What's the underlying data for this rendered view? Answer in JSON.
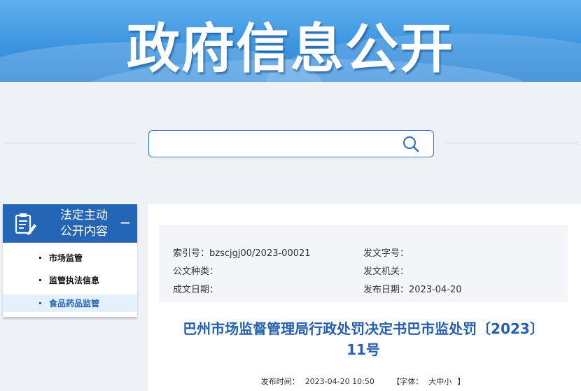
{
  "banner": {
    "title": "政府信息公开"
  },
  "search": {
    "placeholder": "",
    "value": ""
  },
  "sidebar": {
    "title_line1": "法定主动",
    "title_line2": "公开内容",
    "collapse_symbol": "−",
    "items": [
      {
        "label": "市场监管"
      },
      {
        "label": "监管执法信息"
      },
      {
        "label": "食品药品监管"
      }
    ]
  },
  "meta": {
    "index_label": "索引号：",
    "index_value": "bzscjgj00/2023-00021",
    "doc_no_label": "发文字号：",
    "doc_no_value": "",
    "category_label": "公文种类：",
    "category_value": "",
    "issuer_label": "发文机关：",
    "issuer_value": "",
    "created_label": "成文日期：",
    "created_value": "",
    "published_label": "发布日期：",
    "published_value": "2023-04-20"
  },
  "document": {
    "title_line1": "巴州市场监督管理局行政处罚决定书巴市监处罚〔2023〕",
    "title_line2": "11号",
    "pub_time_label": "发布时间：",
    "pub_time_value": "2023-04-20 10:50",
    "font_label": "【字体：",
    "font_sizes": "大中小",
    "font_close": "】"
  },
  "colors": {
    "banner": "#3d94e0",
    "sidebar_head": "#2565b5",
    "title": "#2560b0"
  }
}
